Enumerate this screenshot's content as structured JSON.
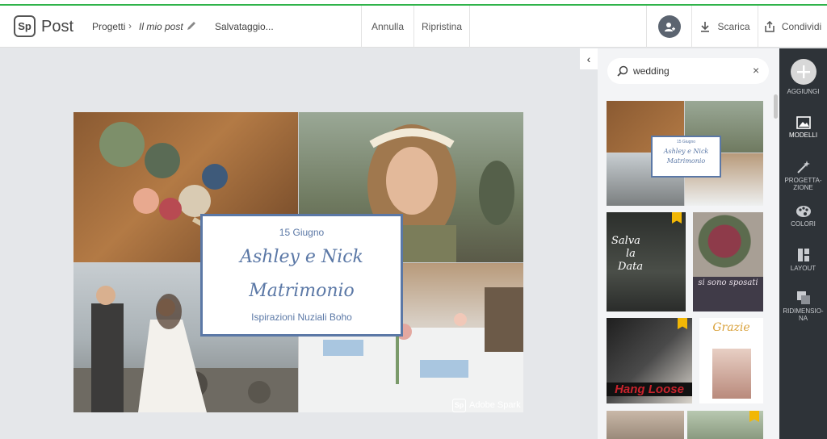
{
  "header": {
    "app_name": "Post",
    "logo_text": "Sp",
    "breadcrumb_projects": "Progetti",
    "breadcrumb_current": "Il mio post",
    "save_status": "Salvataggio...",
    "undo_label": "Annulla",
    "redo_label": "Ripristina",
    "download_label": "Scarica",
    "share_label": "Condividi"
  },
  "post": {
    "date": "15 Giugno",
    "names": "Ashley e Nick",
    "event": "Matrimonio",
    "subtitle": "Ispirazioni Nuziali Boho",
    "watermark_logo": "Sp",
    "watermark": "Adobe Spark"
  },
  "panel": {
    "search_value": "wedding",
    "templates": [
      {
        "title_line1": "15 Giugno",
        "title_line2": "Ashley e Nick",
        "title_line3": "Matrimonio"
      },
      {
        "title_line1": "Salva",
        "title_line2": "la",
        "title_line3": "Data"
      },
      {
        "title_line1": "si sono sposati"
      },
      {
        "title_line1": "Hang Loose"
      },
      {
        "title_line1": "Grazie"
      }
    ]
  },
  "rail": {
    "add": "AGGIUNGI",
    "templates": "MODELLI",
    "design": "PROGETTA-ZIONE",
    "colors": "COLORI",
    "layout": "LAYOUT",
    "resize": "RIDIMENSIO-NA"
  },
  "colors": {
    "accent_green": "#2fb34a",
    "title_blue": "#5b78a6",
    "rail_bg": "#2e3338",
    "badge_gold": "#f2b705"
  }
}
